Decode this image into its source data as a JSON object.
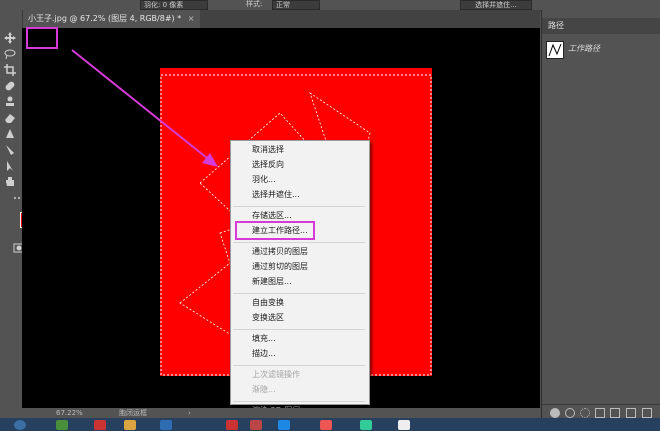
{
  "options_bar": {
    "feather_field": "羽化: 0 像素",
    "style_label": "样式:",
    "style_value": "正常",
    "select_mask_button": "选择并遮住..."
  },
  "document": {
    "tab_title": "小王子.jpg @ 67.2% (图层 4, RGB/8#) *",
    "close_glyph": "×"
  },
  "status_bar": {
    "zoom": "67.22%",
    "mode": "胞闭运框",
    "arrow": "›"
  },
  "panel": {
    "tab_label": "路径",
    "path_item": "工作路径"
  },
  "context_menu": {
    "groups": [
      [
        "取消选择",
        "选择反向",
        "羽化...",
        "选择并遮住..."
      ],
      [
        "存储选区...",
        "建立工作路径..."
      ],
      [
        "通过拷贝的图层",
        "通过剪切的图层",
        "新建图层..."
      ],
      [
        "自由变换",
        "变换选区"
      ],
      [
        "填充...",
        "描边..."
      ],
      [
        "上次滤镜操作",
        "渐隐..."
      ],
      [
        "渲染 3D 图层",
        "新建 3D 模型"
      ]
    ],
    "disabled": [
      "上次滤镜操作",
      "渐隐...",
      "渲染 3D 图层"
    ],
    "highlighted_item": "建立工作路径..."
  },
  "colors": {
    "foreground": "#ff0000",
    "background": "#1e8be0",
    "annotation": "#d63ad7",
    "canvas_fill": "#ff0000"
  },
  "icons": [
    "move-tool-icon",
    "marquee-tool-icon",
    "lasso-tool-icon",
    "magic-wand-icon",
    "crop-tool-icon",
    "eyedropper-icon",
    "healing-brush-icon",
    "brush-tool-icon",
    "clone-stamp-icon",
    "history-brush-icon",
    "eraser-icon",
    "gradient-icon",
    "blur-icon",
    "dodge-icon",
    "pen-tool-icon",
    "type-tool-icon",
    "path-select-icon",
    "rectangle-tool-icon",
    "hand-tool-icon",
    "zoom-tool-icon"
  ]
}
